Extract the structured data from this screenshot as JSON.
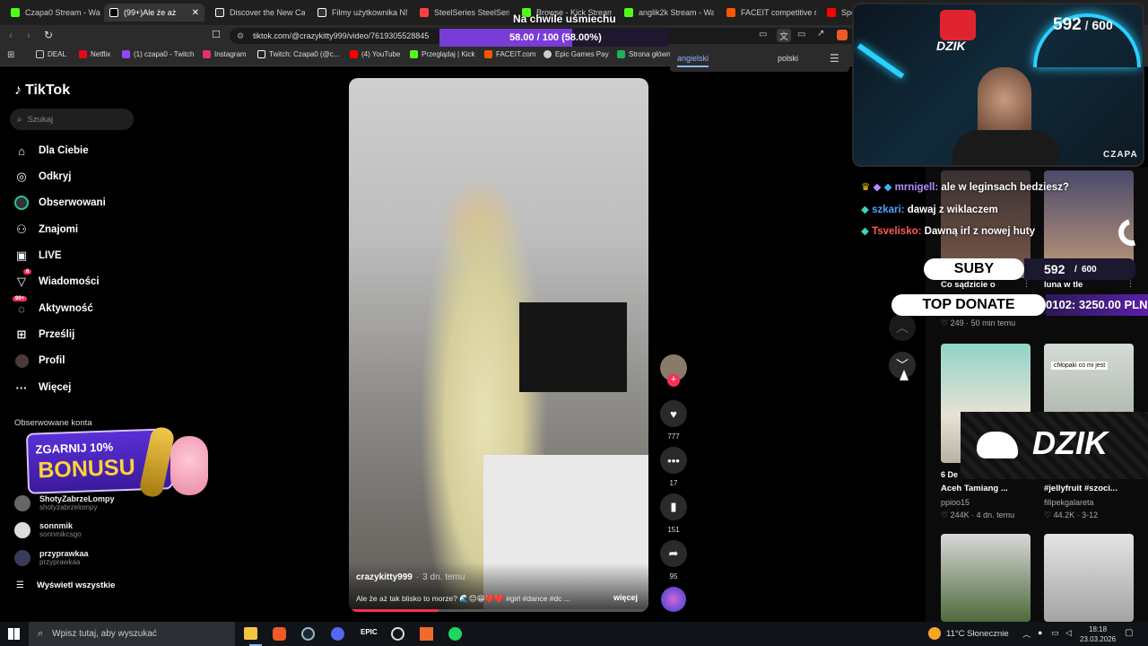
{
  "browser": {
    "tabs": [
      {
        "label": "Czapa0 Stream - Watch",
        "color": "#53fc18"
      },
      {
        "label": "(99+)Ale że aż",
        "color": "#ffffff"
      },
      {
        "label": "Discover the New Cap",
        "color": "#ffffff"
      },
      {
        "label": "Filmy użytkownika NN",
        "color": "#ffffff"
      },
      {
        "label": "SteelSeries SteelSeries",
        "color": "#ff4040"
      },
      {
        "label": "Browse - Kick Streamin",
        "color": "#53fc18"
      },
      {
        "label": "anglik2k Stream - Watc",
        "color": "#53fc18"
      },
      {
        "label": "FACEIT competitive m",
        "color": "#ff5500"
      },
      {
        "label": "Spo",
        "color": "#ff0000"
      }
    ],
    "url": "tiktok.com/@crazykitty999/video/7619305528845",
    "url_tail": "8283837539862",
    "bookmarks": [
      "DEAL",
      "Netflix",
      "(1) czapa0 - Twitch",
      "Instagram",
      "Twitch: Czapa0 (@c...",
      "(4) YouTube",
      "Przeglądaj | Kick",
      "FACEIT.com",
      "Epic Games Pay",
      "Strona główn"
    ],
    "translate": {
      "left": "angielski",
      "right": "polski"
    }
  },
  "overlay": {
    "goal_title": "Na chwile uśmiechu",
    "goal_progress": "58.00 / 100 (58.00%)",
    "goal_fraction": 0.58,
    "subs_count": "592",
    "subs_total": "600",
    "cam_label": "CZAPA",
    "brand": "DZIK",
    "suby_label": "SUBY",
    "suby_count": "592",
    "suby_total": "600",
    "top_donate_label": "TOP DONATE",
    "top_donate_value": "0102: 3250.00 PLN",
    "bonus_line1": "ZGARNIJ 10%",
    "bonus_line2": "BONUSU",
    "chat": [
      {
        "user": "mrnigell:",
        "msg": "ale w leginsach bedziesz?",
        "color": "#b58cff"
      },
      {
        "user": "szkari:",
        "msg": "dawaj z wiklaczem",
        "color": "#4fa3ff"
      },
      {
        "user": "Tsvelisko:",
        "msg": "Dawną irl z nowej huty",
        "color": "#ff5a5a"
      }
    ]
  },
  "tiktok": {
    "logo": "TikTok",
    "search_placeholder": "Szukaj",
    "nav": [
      {
        "label": "Dla Ciebie",
        "icon": "home-icon"
      },
      {
        "label": "Odkryj",
        "icon": "compass-icon"
      },
      {
        "label": "Obserwowani",
        "icon": "following-icon"
      },
      {
        "label": "Znajomi",
        "icon": "friends-icon"
      },
      {
        "label": "LIVE",
        "icon": "live-icon"
      },
      {
        "label": "Wiadomości",
        "icon": "inbox-icon",
        "badge": "6"
      },
      {
        "label": "Aktywność",
        "icon": "activity-icon",
        "badge": "99+"
      },
      {
        "label": "Prześlij",
        "icon": "upload-icon"
      },
      {
        "label": "Profil",
        "icon": "profile-icon"
      },
      {
        "label": "Więcej",
        "icon": "more-icon"
      }
    ],
    "followed_header": "Obserwowane konta",
    "followed": [
      {
        "name": "ShotyZabrzeLompy",
        "handle": "shotyzabrzelompy"
      },
      {
        "name": "sonnmik",
        "handle": "sonnmikcsgo"
      },
      {
        "name": "przyprawkaa",
        "handle": "przyprawkaa"
      }
    ],
    "see_all": "Wyświetl wszystkie",
    "video": {
      "author": "crazykitty999",
      "time": "3 dn. temu",
      "caption": "Ale że aż tak blisko to morze? 🌊😊😁❤️❤️ #girl #dance #dc ...",
      "more": "więcej",
      "likes": "777",
      "comments": "17",
      "saves": "151",
      "shares": "95"
    },
    "feed": [
      {
        "title": "Co sądzicie o",
        "user": "",
        "stats": "249 · 50 min temu"
      },
      {
        "title": "luna w tle",
        "user": "",
        "stats": ""
      },
      {
        "title": "Aceh Tamiang ...",
        "user": "ppioo15",
        "stats": "244K · 4 dn. temu",
        "overlay": "6 De"
      },
      {
        "title": "#jellyfruit #szoci...",
        "user": "filipekgalareta",
        "stats": "44.2K · 3-12",
        "overlay": "chłopaki co mi jest"
      }
    ]
  },
  "taskbar": {
    "search_placeholder": "Wpisz tutaj, aby wyszukać",
    "weather": "11°C  Słonecznie",
    "time": "18:18",
    "date": "23.03.2026"
  }
}
